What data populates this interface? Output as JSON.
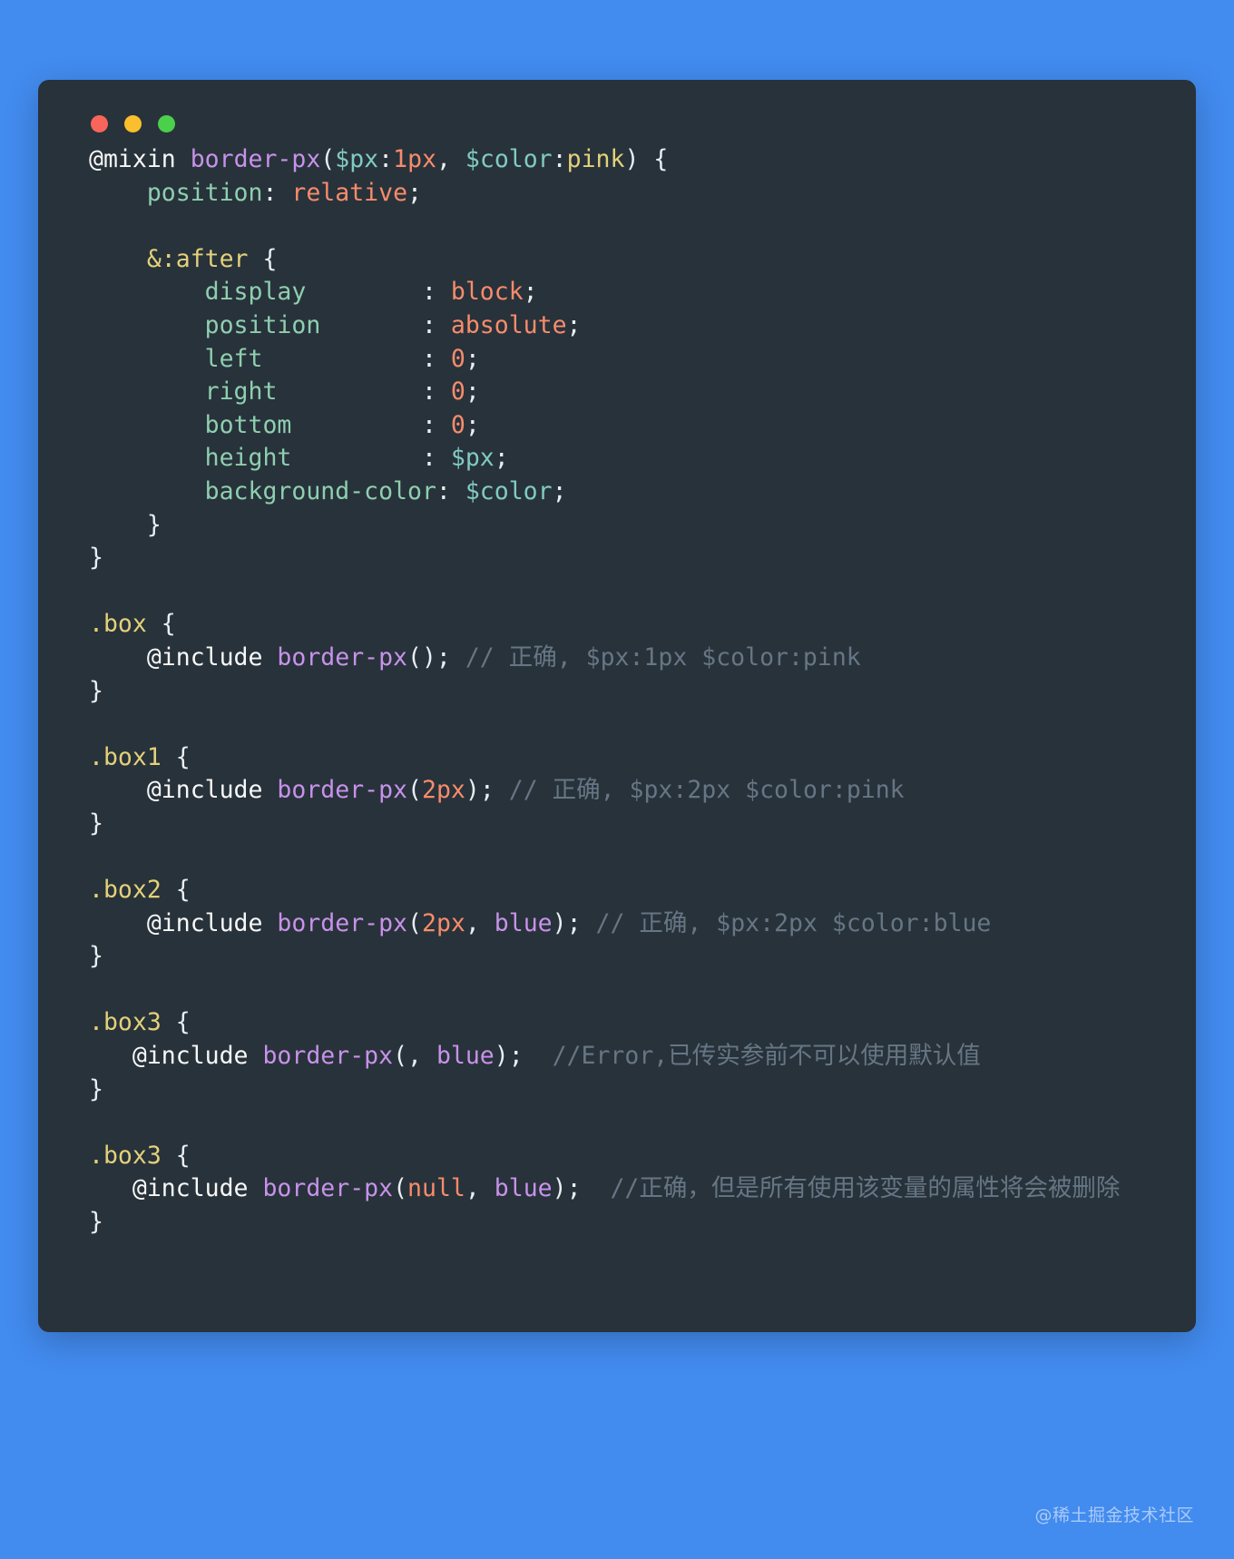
{
  "window": {
    "background_color": "#428bef",
    "code_background_color": "#28323a",
    "traffic_lights": [
      {
        "name": "close",
        "color": "#f9655b"
      },
      {
        "name": "minimize",
        "color": "#fbbf2d"
      },
      {
        "name": "maximize",
        "color": "#4ad04a"
      }
    ]
  },
  "language": "scss",
  "theme": {
    "text": "#e8eef2",
    "function": "#c792ea",
    "variable": "#80cbc4",
    "number": "#f78c6c",
    "value": "#f78c6c",
    "property": "#8ecfb0",
    "selector": "#e3d17a",
    "comment": "#667685"
  },
  "code": {
    "l01_mixin": "@mixin",
    "l01_name": "border-px",
    "l01_open_paren": "(",
    "l01_arg1_var": "$px",
    "l01_arg1_sep": ":",
    "l01_arg1_val": "1px",
    "l01_comma": ", ",
    "l01_arg2_var": "$color",
    "l01_arg2_sep": ":",
    "l01_arg2_val": "pink",
    "l01_close": ") {",
    "l02_prop": "    position",
    "l02_colon": ": ",
    "l02_val": "relative",
    "l02_semi": ";",
    "l04_sel": "    &:after",
    "l04_brace": " {",
    "l05_prop": "        display        ",
    "l05_colon": ": ",
    "l05_val": "block",
    "l05_semi": ";",
    "l06_prop": "        position       ",
    "l06_colon": ": ",
    "l06_val": "absolute",
    "l06_semi": ";",
    "l07_prop": "        left           ",
    "l07_colon": ": ",
    "l07_val": "0",
    "l07_semi": ";",
    "l08_prop": "        right          ",
    "l08_colon": ": ",
    "l08_val": "0",
    "l08_semi": ";",
    "l09_prop": "        bottom         ",
    "l09_colon": ": ",
    "l09_val": "0",
    "l09_semi": ";",
    "l10_prop": "        height         ",
    "l10_colon": ": ",
    "l10_val": "$px",
    "l10_semi": ";",
    "l11_prop": "        background-color",
    "l11_colon": ": ",
    "l11_val": "$color",
    "l11_semi": ";",
    "l12_close_inner": "    }",
    "l13_close_outer": "}",
    "l15_sel": ".box",
    "l15_brace": " {",
    "l16_at": "    @include ",
    "l16_fn": "border-px",
    "l16_args": "();",
    "l16_comment": " // 正确, $px:1px $color:pink",
    "l17_close": "}",
    "l19_sel": ".box1",
    "l19_brace": " {",
    "l20_at": "    @include ",
    "l20_fn": "border-px",
    "l20_p1": "(",
    "l20_num": "2px",
    "l20_p2": ");",
    "l20_comment": " // 正确, $px:2px $color:pink",
    "l21_close": "}",
    "l23_sel": ".box2",
    "l23_brace": " {",
    "l24_at": "    @include ",
    "l24_fn": "border-px",
    "l24_p1": "(",
    "l24_num": "2px",
    "l24_comma": ", ",
    "l24_kw": "blue",
    "l24_p2": ");",
    "l24_comment": " // 正确, $px:2px $color:blue",
    "l25_close": "}",
    "l27_sel": ".box3",
    "l27_brace": " {",
    "l28_at": "   @include ",
    "l28_fn": "border-px",
    "l28_p1": "(, ",
    "l28_kw": "blue",
    "l28_p2": ");",
    "l28_comment": "  //Error,已传实参前不可以使用默认值",
    "l29_close": "}",
    "l31_sel": ".box3",
    "l31_brace": " {",
    "l32_at": "   @include ",
    "l32_fn": "border-px",
    "l32_p1": "(",
    "l32_null": "null",
    "l32_comma": ", ",
    "l32_kw": "blue",
    "l32_p2": ");",
    "l32_comment": "  //正确，但是所有使用该变量的属性将会被删除",
    "l33_close": "}"
  },
  "watermark": "@稀土掘金技术社区"
}
